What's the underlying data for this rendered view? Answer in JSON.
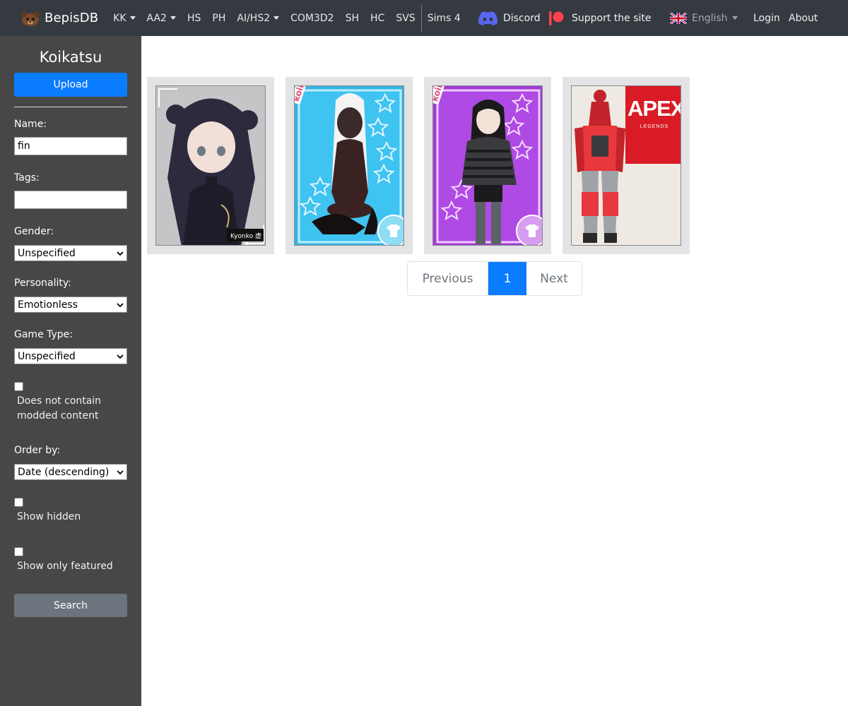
{
  "navbar": {
    "brand": "BepisDB",
    "links": [
      {
        "label": "KK",
        "dropdown": true
      },
      {
        "label": "AA2",
        "dropdown": true
      },
      {
        "label": "HS",
        "dropdown": false
      },
      {
        "label": "PH",
        "dropdown": false
      },
      {
        "label": "AI/HS2",
        "dropdown": true
      },
      {
        "label": "COM3D2",
        "dropdown": false
      },
      {
        "label": "SH",
        "dropdown": false
      },
      {
        "label": "HC",
        "dropdown": false
      },
      {
        "label": "SVS",
        "dropdown": false
      },
      {
        "label": "Sims 4",
        "dropdown": false
      }
    ],
    "discord": "Discord",
    "support": "Support the site",
    "language": "English",
    "login": "Login",
    "about": "About",
    "colors": {
      "background": "#343a40",
      "discord": "#5865f2",
      "patreon": "#ff424d"
    }
  },
  "sidebar": {
    "title": "Koikatsu",
    "upload_label": "Upload",
    "name_label": "Name:",
    "name_value": "fin",
    "tags_label": "Tags:",
    "tags_value": "",
    "gender_label": "Gender:",
    "gender_value": "Unspecified",
    "personality_label": "Personality:",
    "personality_value": "Emotionless",
    "game_type_label": "Game Type:",
    "game_type_value": "Unspecified",
    "no_modded_label": "Does not contain modded content",
    "order_label": "Order by:",
    "order_value": "Date (descending)",
    "show_hidden_label": "Show hidden",
    "show_featured_label": "Show only featured",
    "search_label": "Search",
    "colors": {
      "background": "#474747",
      "primary": "#0a7cff",
      "secondary": "#6c757d"
    }
  },
  "cards": [
    {
      "theme": "dark-dress",
      "badge": "Kyonko 虚子"
    },
    {
      "theme": "blue-koikatsu",
      "stamp": "koikatsu"
    },
    {
      "theme": "purple-koikatsu",
      "stamp": "koikatsu"
    },
    {
      "theme": "apex-legends",
      "logo": "APEX",
      "logo_sub": "LEGENDS"
    }
  ],
  "pagination": {
    "previous": "Previous",
    "current": "1",
    "next": "Next"
  }
}
